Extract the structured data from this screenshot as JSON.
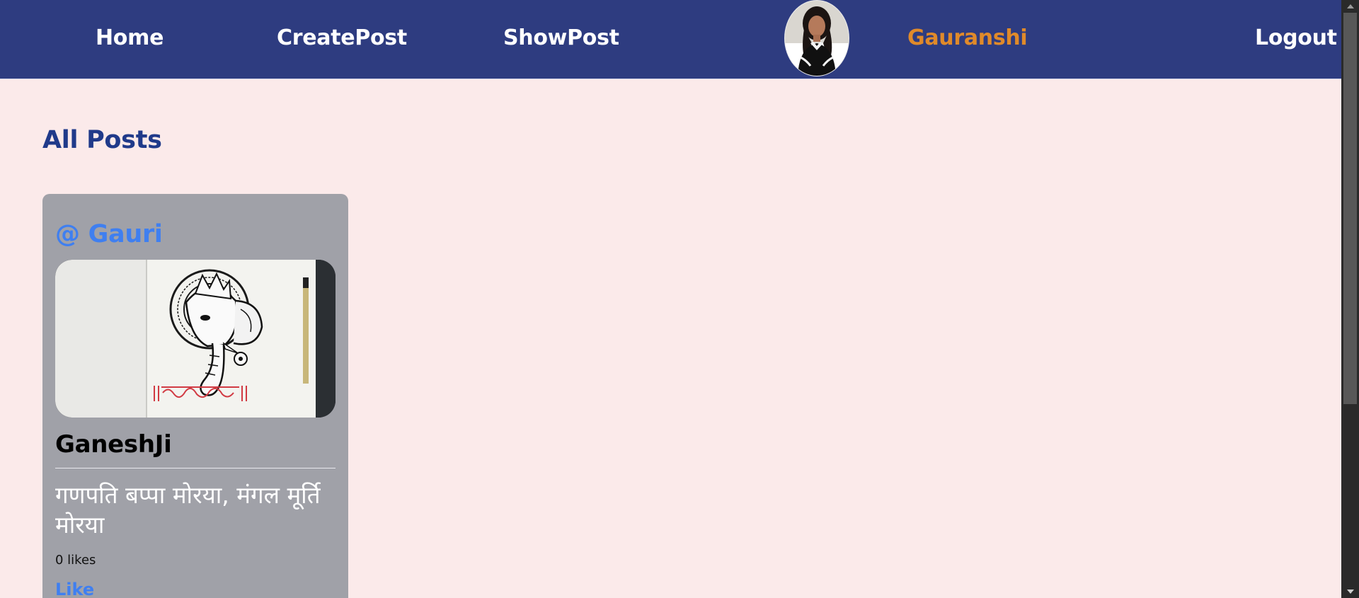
{
  "nav": {
    "home_label": "Home",
    "create_post_label": "CreatePost",
    "show_post_label": "ShowPost",
    "username": "Gauranshi",
    "logout_label": "Logout",
    "avatar_icon": "user-avatar-photo"
  },
  "main": {
    "page_title": "All Posts"
  },
  "posts": [
    {
      "author": "@ Gauri",
      "image_icon": "ganesh-sketch-image",
      "title": "GaneshJi",
      "body": "गणपति बप्पा मोरया, मंगल मूर्ति मोरया",
      "likes": "0 likes",
      "like_label": "Like"
    }
  ],
  "colors": {
    "navbar_bg": "#2e3c80",
    "page_bg": "#fbeaea",
    "username": "#e08a2a",
    "title": "#203a8a",
    "author": "#3f7ff0",
    "card_bg": "#a0a1a8"
  }
}
